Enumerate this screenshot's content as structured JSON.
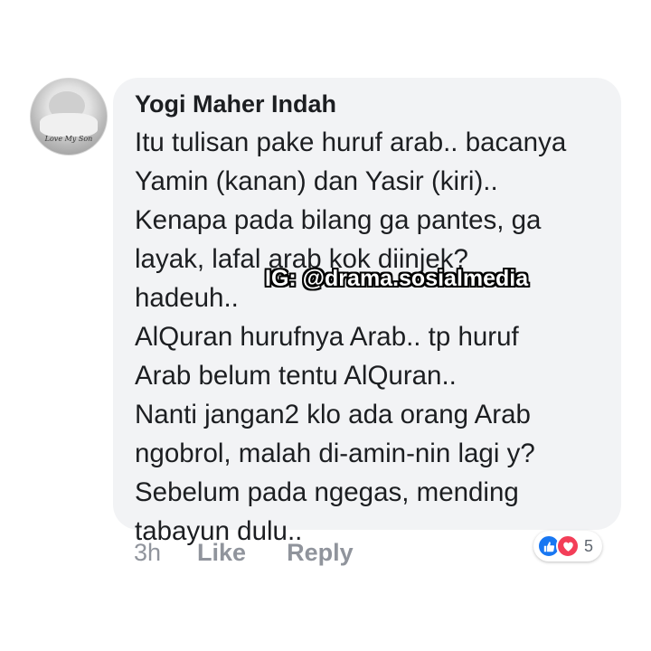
{
  "comment": {
    "author": "Yogi Maher Indah",
    "avatar_caption": "Love My Son",
    "lines": [
      "Itu tulisan pake huruf arab.. bacanya",
      "Yamin (kanan) dan Yasir (kiri)..",
      "Kenapa pada bilang ga pantes, ga",
      "layak, lafal arab kok diinjek?",
      "hadeuh..",
      "AlQuran hurufnya Arab.. tp huruf",
      "Arab belum tentu AlQuran..",
      "Nanti jangan2 klo ada orang Arab",
      "ngobrol, malah di-amin-nin lagi y?",
      "Sebelum pada ngegas, mending",
      "tabayun dulu.."
    ],
    "time": "3h",
    "like_label": "Like",
    "reply_label": "Reply",
    "reaction_count": "5",
    "reactions": [
      "like-icon",
      "love-icon"
    ]
  },
  "watermark": "IG: @drama.sosialmedia",
  "colors": {
    "bubble": "#f2f3f5",
    "text": "#1c1e21",
    "meta": "#90949c",
    "like_blue": "#1877f2",
    "love_red": "#f33e58"
  }
}
